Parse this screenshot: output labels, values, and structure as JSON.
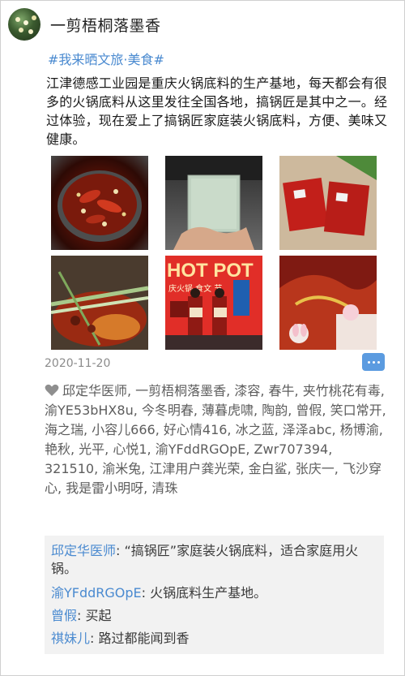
{
  "post": {
    "username": "一剪梧桐落墨香",
    "hashtag": "#我来晒文旅·美食#",
    "text": "江津德感工业园是重庆火锅底料的生产基地，每天都会有很多的火锅底料从这里发往全国各地，搞锅匠是其中之一。经过体验，现在爱上了搞锅匠家庭装火锅底料，方便、美味又健康。",
    "date": "2020-11-20",
    "photos": [
      {
        "icon": "hotpot-photo-1"
      },
      {
        "icon": "hotpot-photo-2"
      },
      {
        "icon": "hotpot-photo-3"
      },
      {
        "icon": "hotpot-photo-4"
      },
      {
        "icon": "hotpot-photo-5",
        "banner": "HOT POT",
        "sign": "庆火锅 食文 节"
      },
      {
        "icon": "hotpot-photo-6"
      }
    ]
  },
  "likes": {
    "text": "邱定华医师, 一剪梧桐落墨香, 漆容, 春牛, 夹竹桃花有毒, 渝YE53bHX8u, 今冬明春, 薄暮虎啸, 陶韵, 曾假, 笑口常开, 海之瑞, 小容儿666, 好心情416, 冰之蓝, 泽泽abc, 杨博渝, 艳秋, 光平, 心悦1, 渝YFddRGOpE, Zwr707394, 321510, 渝米兔, 江津用户龚光荣, 金白鲨, 张庆一, 飞沙穿心, 我是雷小明呀, 清珠"
  },
  "comments": [
    {
      "name": "邱定华医师",
      "sep": ": ",
      "text": "“搞锅匠”家庭装火锅底料，适合家庭用火锅。"
    },
    {
      "name": "渝YFddRGOpE",
      "sep": ": ",
      "text": "火锅底料生产基地。"
    },
    {
      "name": "曾假",
      "sep": ": ",
      "text": "买起"
    },
    {
      "name": "祺妹儿",
      "sep": ": ",
      "text": "路过都能闻到香"
    }
  ],
  "colors": {
    "link": "#4a8ad0",
    "comment_bg": "#f2f2f2",
    "action_button": "#5b9be0"
  }
}
